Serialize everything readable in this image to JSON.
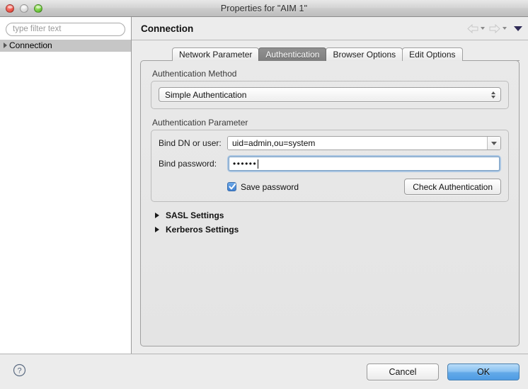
{
  "window": {
    "title": "Properties for \"AIM 1\"",
    "controls": {
      "close": "close-button",
      "minimize": "minimize-button",
      "zoom": "zoom-button"
    }
  },
  "sidebar": {
    "filter": {
      "placeholder": "type filter text",
      "value": ""
    },
    "tree": [
      {
        "label": "Connection",
        "selected": true,
        "expanded": false
      }
    ]
  },
  "content": {
    "heading": "Connection",
    "nav": {
      "back": "back-arrow",
      "forward": "forward-arrow",
      "menu": "view-menu-caret"
    },
    "tabs": [
      {
        "label": "Network Parameter",
        "active": false
      },
      {
        "label": "Authentication",
        "active": true
      },
      {
        "label": "Browser Options",
        "active": false
      },
      {
        "label": "Edit Options",
        "active": false
      }
    ],
    "auth_method": {
      "group_label": "Authentication Method",
      "selected": "Simple Authentication"
    },
    "auth_parameter": {
      "group_label": "Authentication Parameter",
      "bind_dn": {
        "label": "Bind DN or user:",
        "value": "uid=admin,ou=system"
      },
      "bind_password": {
        "label": "Bind password:",
        "value": "••••••",
        "focused": true
      },
      "save_password": {
        "label": "Save password",
        "checked": true
      },
      "check_auth_button": "Check Authentication"
    },
    "expanders": [
      {
        "label": "SASL Settings",
        "expanded": false
      },
      {
        "label": "Kerberos Settings",
        "expanded": false
      }
    ]
  },
  "footer": {
    "help": "?",
    "cancel": "Cancel",
    "ok": "OK"
  },
  "colors": {
    "accent_blue": "#4f9ce4",
    "checkbox_blue": "#3f7fd0",
    "active_tab_gray": "#7f7f7f",
    "selection_gray": "#c6c6c6",
    "window_bg": "#ececec",
    "focus_ring": "#76a9de"
  }
}
